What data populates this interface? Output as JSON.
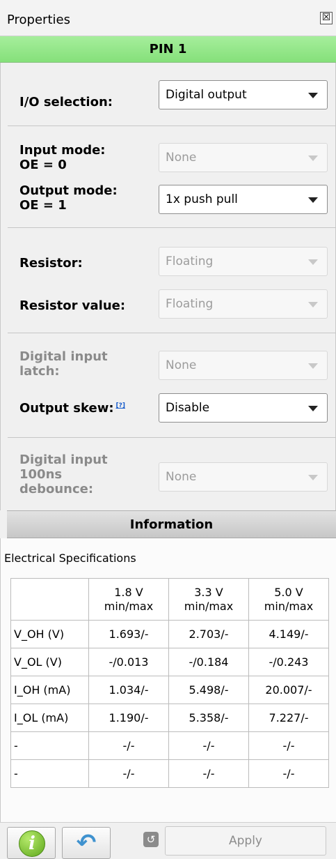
{
  "titlebar": {
    "title": "Properties",
    "close_icon": "☒"
  },
  "pin": {
    "label": "PIN 1"
  },
  "form": {
    "io_selection": {
      "label": "I/O selection:",
      "value": "Digital output"
    },
    "input_mode": {
      "label_line1": "Input mode:",
      "label_line2": "OE = 0",
      "value": "None"
    },
    "output_mode": {
      "label_line1": "Output mode:",
      "label_line2": "OE = 1",
      "value": "1x push pull"
    },
    "resistor": {
      "label": "Resistor:",
      "value": "Floating"
    },
    "resistor_value": {
      "label": "Resistor value:",
      "value": "Floating"
    },
    "digital_input_latch": {
      "label_line1": "Digital input",
      "label_line2": "latch:",
      "value": "None"
    },
    "output_skew": {
      "label": "Output skew:",
      "help": "[?]",
      "value": "Disable"
    },
    "debounce": {
      "label_line1": "Digital input",
      "label_line2": "100ns",
      "label_line3": "debounce:",
      "value": "None"
    }
  },
  "information": {
    "header": "Information",
    "section_title": "Electrical Specifications",
    "columns": [
      {
        "v": "1.8 V",
        "sub": "min/max"
      },
      {
        "v": "3.3 V",
        "sub": "min/max"
      },
      {
        "v": "5.0 V",
        "sub": "min/max"
      }
    ],
    "rows": [
      {
        "name": "V_OH (V)",
        "c1": "1.693/-",
        "c2": "2.703/-",
        "c3": "4.149/-"
      },
      {
        "name": "V_OL (V)",
        "c1": "-/0.013",
        "c2": "-/0.184",
        "c3": "-/0.243"
      },
      {
        "name": "I_OH (mA)",
        "c1": "1.034/-",
        "c2": "5.498/-",
        "c3": "20.007/-"
      },
      {
        "name": "I_OL (mA)",
        "c1": "1.190/-",
        "c2": "5.358/-",
        "c3": "7.227/-"
      },
      {
        "name": "-",
        "c1": "-/-",
        "c2": "-/-",
        "c3": "-/-"
      },
      {
        "name": "-",
        "c1": "-/-",
        "c2": "-/-",
        "c3": "-/-"
      }
    ]
  },
  "footer": {
    "info_glyph": "i",
    "undo_glyph": "↶",
    "small_undo_glyph": "↺",
    "apply_label": "Apply"
  }
}
